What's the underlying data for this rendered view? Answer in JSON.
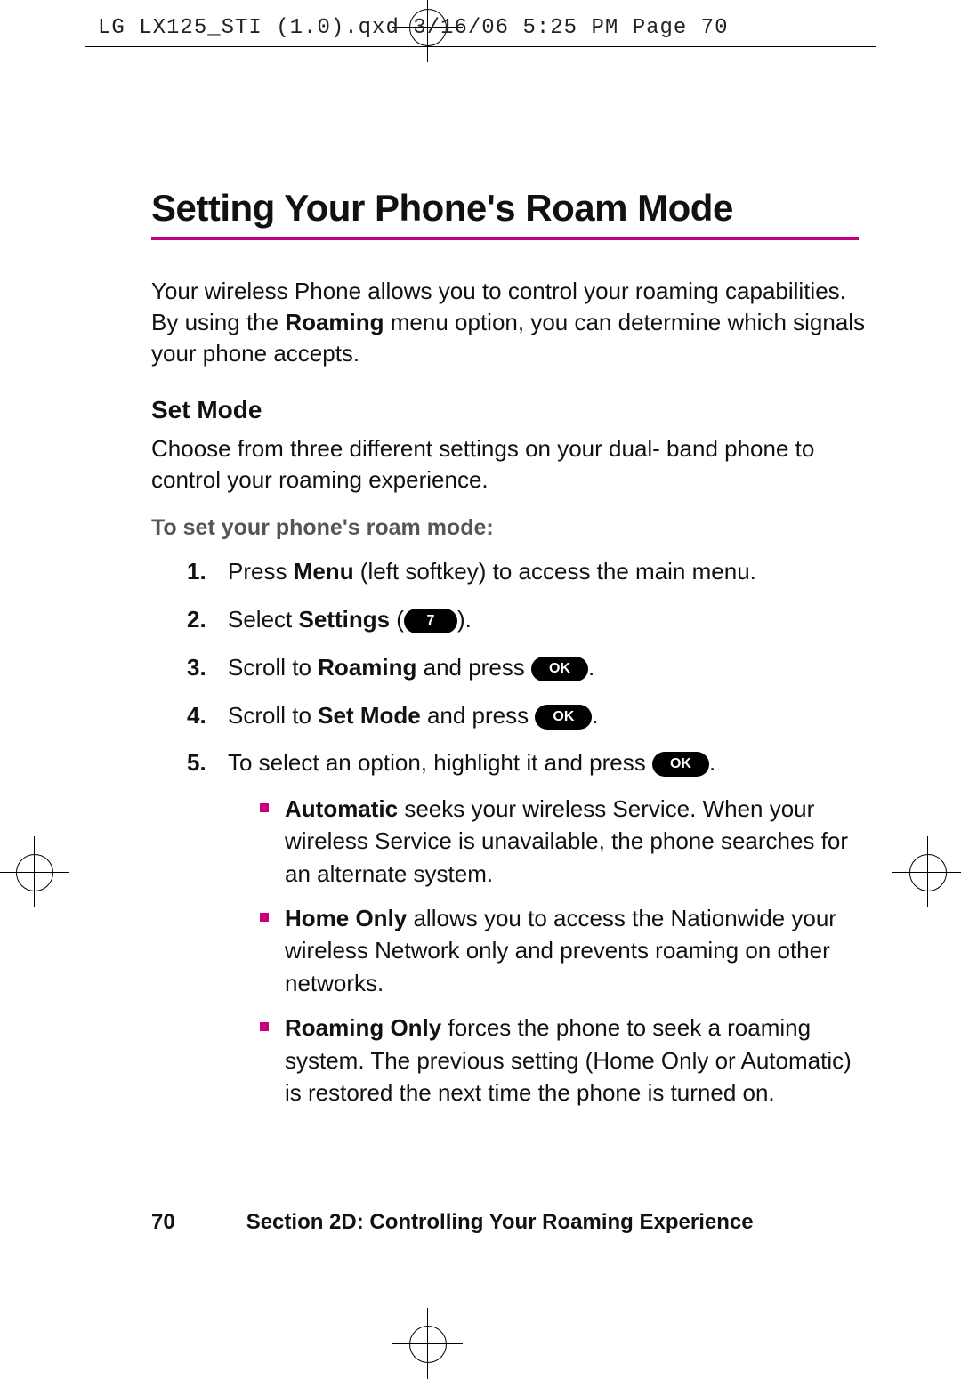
{
  "slug": "LG LX125_STI (1.0).qxd  3/16/06  5:25 PM  Page 70",
  "title": "Setting Your Phone's Roam Mode",
  "intro_pre": "Your wireless Phone allows you to control your roaming capabilities. By using the ",
  "intro_bold": "Roaming",
  "intro_post": " menu option, you can determine which signals your phone accepts.",
  "subhead": "Set Mode",
  "set_mode_body": "Choose from three different settings on your dual- band phone to control your roaming experience.",
  "lead": "To set your phone's roam mode:",
  "steps": {
    "s1": {
      "num": "1.",
      "pre": "Press ",
      "b": "Menu",
      "post": " (left softkey) to access the main menu."
    },
    "s2": {
      "num": "2.",
      "pre": "Select ",
      "b": "Settings",
      "post_open": " (",
      "pill": "7",
      "post_close": ")."
    },
    "s3": {
      "num": "3.",
      "pre": "Scroll to ",
      "b": "Roaming",
      "mid": " and press ",
      "pill": "OK",
      "post": "."
    },
    "s4": {
      "num": "4.",
      "pre": "Scroll to ",
      "b": "Set Mode",
      "mid": " and press ",
      "pill": "OK",
      "post": "."
    },
    "s5": {
      "num": "5.",
      "pre": "To select an option, highlight it and press ",
      "pill": "OK",
      "post": "."
    }
  },
  "options": {
    "o1": {
      "b": "Automatic",
      "rest": " seeks your wireless Service. When your wireless Service is unavailable, the phone searches for an alternate system."
    },
    "o2": {
      "b": "Home Only",
      "rest": " allows you to access the Nationwide your wireless Network only and prevents roaming on other networks."
    },
    "o3": {
      "b": "Roaming Only",
      "rest": " forces the phone to seek a roaming system. The previous setting (Home Only or Automatic) is restored the next time the phone is turned on."
    }
  },
  "footer": {
    "page": "70",
    "section": "Section 2D: Controlling Your Roaming Experience"
  }
}
